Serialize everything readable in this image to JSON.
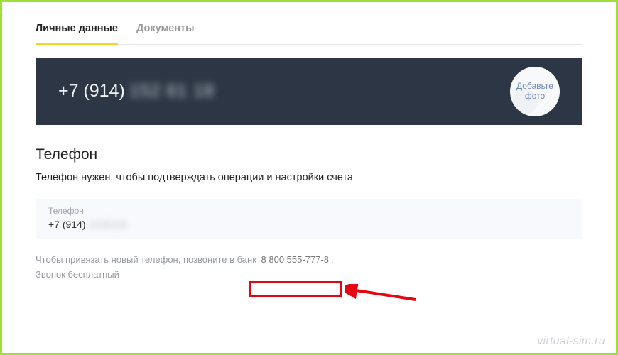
{
  "tabs": {
    "personal": "Личные данные",
    "documents": "Документы"
  },
  "header": {
    "phone_prefix": "+7 (914)",
    "phone_masked": "152 61 18",
    "avatar_line1": "Добавьте",
    "avatar_line2": "фото"
  },
  "section": {
    "title": "Телефон",
    "desc": "Телефон нужен, чтобы подтверждать операции и настройки счета"
  },
  "field": {
    "label": "Телефон",
    "value_prefix": "+7 (914)",
    "value_masked": "1526118"
  },
  "note": {
    "line1_pre": "Чтобы привязать новый телефон, позвоните в банк ",
    "support_number": "8 800 555-777-8",
    "line1_post": ".",
    "line2": "Звонок бесплатный"
  },
  "watermark": "virtual-sim.ru"
}
